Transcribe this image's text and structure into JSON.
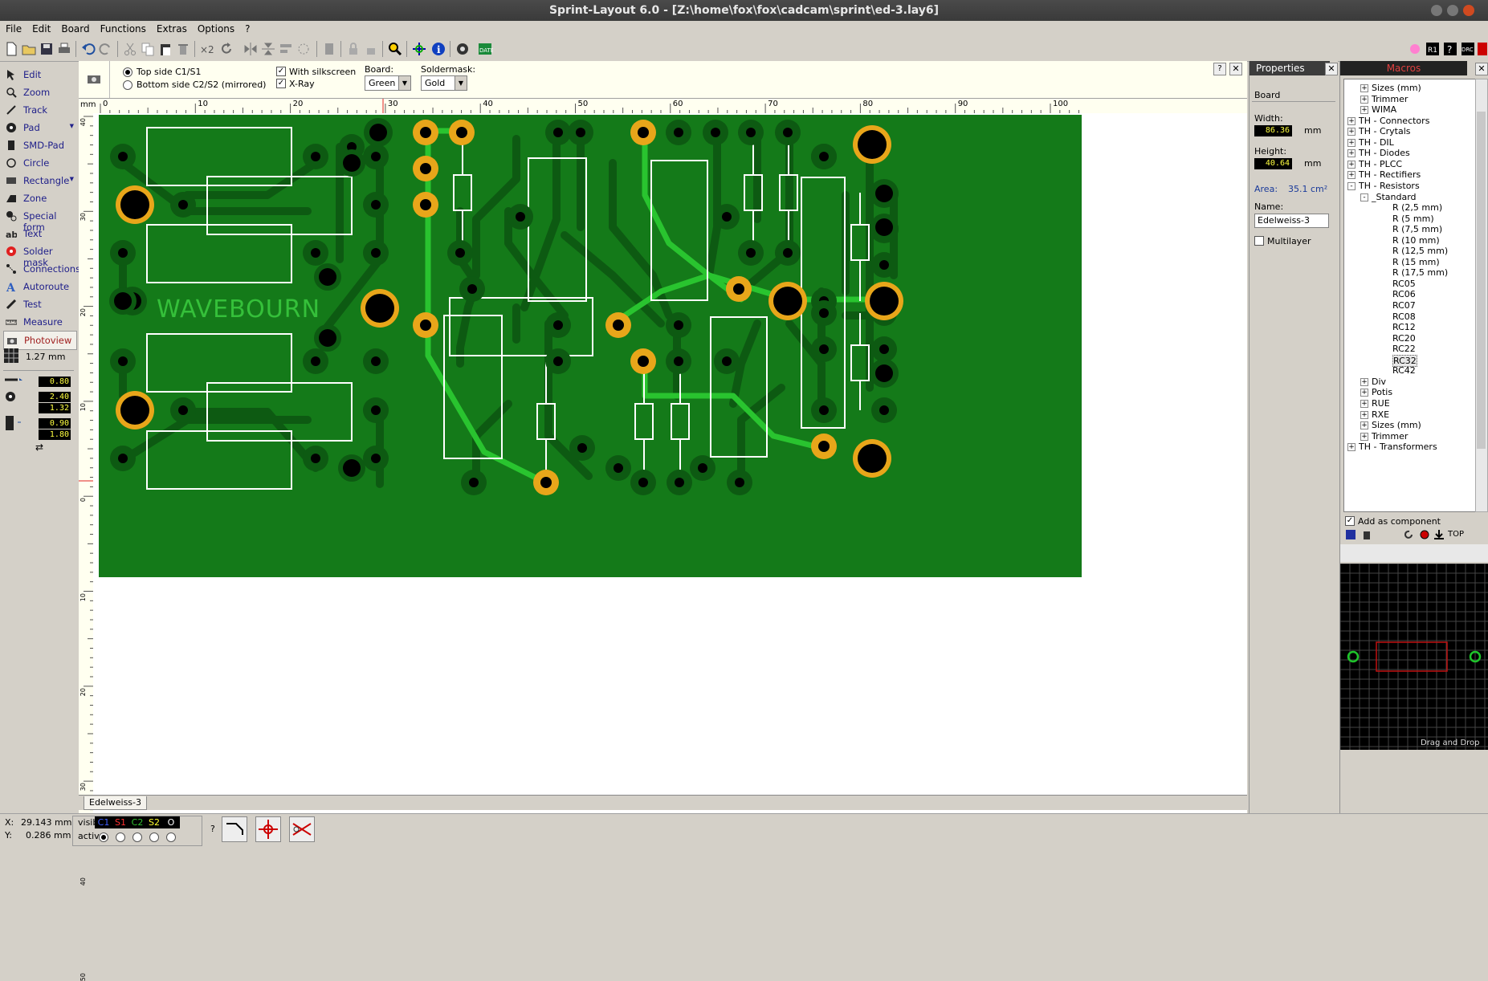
{
  "window": {
    "title": "Sprint-Layout 6.0 - [Z:\\home\\fox\\fox\\cadcam\\sprint\\ed-3.lay6]"
  },
  "menu": [
    "File",
    "Edit",
    "Board",
    "Functions",
    "Extras",
    "Options",
    "?"
  ],
  "tools": [
    {
      "label": "Edit",
      "icon": "cursor-arrow-icon"
    },
    {
      "label": "Zoom",
      "icon": "magnifier-icon"
    },
    {
      "label": "Track",
      "icon": "track-pen-icon"
    },
    {
      "label": "Pad",
      "icon": "pad-circle-icon"
    },
    {
      "label": "SMD-Pad",
      "icon": "smd-pad-icon"
    },
    {
      "label": "Circle",
      "icon": "circle-icon"
    },
    {
      "label": "Rectangle",
      "icon": "rectangle-icon"
    },
    {
      "label": "Zone",
      "icon": "zone-icon"
    },
    {
      "label": "Special form",
      "icon": "special-form-icon"
    },
    {
      "label": "Text",
      "icon": "text-ab-icon"
    },
    {
      "label": "Solder mask",
      "icon": "solder-mask-icon"
    },
    {
      "label": "Connections",
      "icon": "connections-icon"
    },
    {
      "label": "Autoroute",
      "icon": "autoroute-icon"
    },
    {
      "label": "Test",
      "icon": "test-pen-icon"
    },
    {
      "label": "Measure",
      "icon": "measure-ruler-icon"
    },
    {
      "label": "Photoview",
      "icon": "camera-icon"
    }
  ],
  "grid": {
    "value": "1.27 mm"
  },
  "params": {
    "track_width": "0.80",
    "pad_outer": "2.40",
    "pad_inner": "1.32",
    "smd_w": "0.90",
    "smd_h": "1.80"
  },
  "options": {
    "top_side": "Top side C1/S1",
    "bottom_side": "Bottom side C2/S2 (mirrored)",
    "with_silkscreen": "With silkscreen",
    "xray": "X-Ray",
    "board_label": "Board:",
    "board_value": "Green",
    "soldermask_label": "Soldermask:",
    "soldermask_value": "Gold"
  },
  "ruler": {
    "unit": "mm",
    "top_ticks": [
      "0",
      "10",
      "20",
      "30",
      "40",
      "50",
      "60",
      "70",
      "80",
      "90",
      "100"
    ],
    "left_ticks": [
      "40",
      "30",
      "20",
      "10",
      "0",
      "10",
      "20",
      "30",
      "40",
      "50"
    ]
  },
  "board_text": {
    "silk": "WAVEBOURN"
  },
  "properties": {
    "title": "Properties",
    "section": "Board",
    "width_label": "Width:",
    "width_value": "86.36",
    "height_label": "Height:",
    "height_value": "40.64",
    "unit": "mm",
    "area_label": "Area:",
    "area_value": "35.1 cm²",
    "name_label": "Name:",
    "name_value": "Edelweiss-3",
    "multilayer": "Multilayer"
  },
  "macros": {
    "title": "Macros",
    "tree": [
      {
        "label": "Sizes (mm)",
        "level": 2,
        "exp": "+"
      },
      {
        "label": "Trimmer",
        "level": 2,
        "exp": "+"
      },
      {
        "label": "WIMA",
        "level": 2,
        "exp": "+"
      },
      {
        "label": "TH - Connectors",
        "level": 1,
        "exp": "+"
      },
      {
        "label": "TH - Crytals",
        "level": 1,
        "exp": "+"
      },
      {
        "label": "TH - DIL",
        "level": 1,
        "exp": "+"
      },
      {
        "label": "TH - Diodes",
        "level": 1,
        "exp": "+"
      },
      {
        "label": "TH - PLCC",
        "level": 1,
        "exp": "+"
      },
      {
        "label": "TH - Rectifiers",
        "level": 1,
        "exp": "+"
      },
      {
        "label": "TH - Resistors",
        "level": 1,
        "exp": "-"
      },
      {
        "label": "_Standard",
        "level": 2,
        "exp": "-"
      },
      {
        "label": "R (2,5 mm)",
        "level": 3,
        "exp": ""
      },
      {
        "label": "R (5 mm)",
        "level": 3,
        "exp": ""
      },
      {
        "label": "R (7,5 mm)",
        "level": 3,
        "exp": ""
      },
      {
        "label": "R (10 mm)",
        "level": 3,
        "exp": ""
      },
      {
        "label": "R (12,5 mm)",
        "level": 3,
        "exp": ""
      },
      {
        "label": "R (15 mm)",
        "level": 3,
        "exp": ""
      },
      {
        "label": "R (17,5 mm)",
        "level": 3,
        "exp": ""
      },
      {
        "label": "RC05",
        "level": 3,
        "exp": ""
      },
      {
        "label": "RC06",
        "level": 3,
        "exp": ""
      },
      {
        "label": "RC07",
        "level": 3,
        "exp": ""
      },
      {
        "label": "RC08",
        "level": 3,
        "exp": ""
      },
      {
        "label": "RC12",
        "level": 3,
        "exp": ""
      },
      {
        "label": "RC20",
        "level": 3,
        "exp": ""
      },
      {
        "label": "RC22",
        "level": 3,
        "exp": ""
      },
      {
        "label": "RC32",
        "level": 3,
        "exp": "",
        "selected": true
      },
      {
        "label": "RC42",
        "level": 3,
        "exp": ""
      },
      {
        "label": "Div",
        "level": 2,
        "exp": "+"
      },
      {
        "label": "Potis",
        "level": 2,
        "exp": "+"
      },
      {
        "label": "RUE",
        "level": 2,
        "exp": "+"
      },
      {
        "label": "RXE",
        "level": 2,
        "exp": "+"
      },
      {
        "label": "Sizes (mm)",
        "level": 2,
        "exp": "+"
      },
      {
        "label": "Trimmer",
        "level": 2,
        "exp": "+"
      },
      {
        "label": "TH - Transformers",
        "level": 1,
        "exp": "+"
      }
    ],
    "add_as_component": "Add as component",
    "top_label": "TOP",
    "drag_drop": "Drag and Drop"
  },
  "tab": {
    "name": "Edelweiss-3"
  },
  "status": {
    "x_label": "X:",
    "x_value": "29.143 mm",
    "y_label": "Y:",
    "y_value": "0.286 mm",
    "visible": "visible",
    "active": "active",
    "layers": [
      "C1",
      "S1",
      "C2",
      "S2",
      "O"
    ],
    "help": "?"
  },
  "colors": {
    "board": "#147a19",
    "track_dark": "#0d5a12",
    "track_bright": "#29c42f",
    "pad_gold": "#e8a61a",
    "silk": "#ffffff"
  }
}
